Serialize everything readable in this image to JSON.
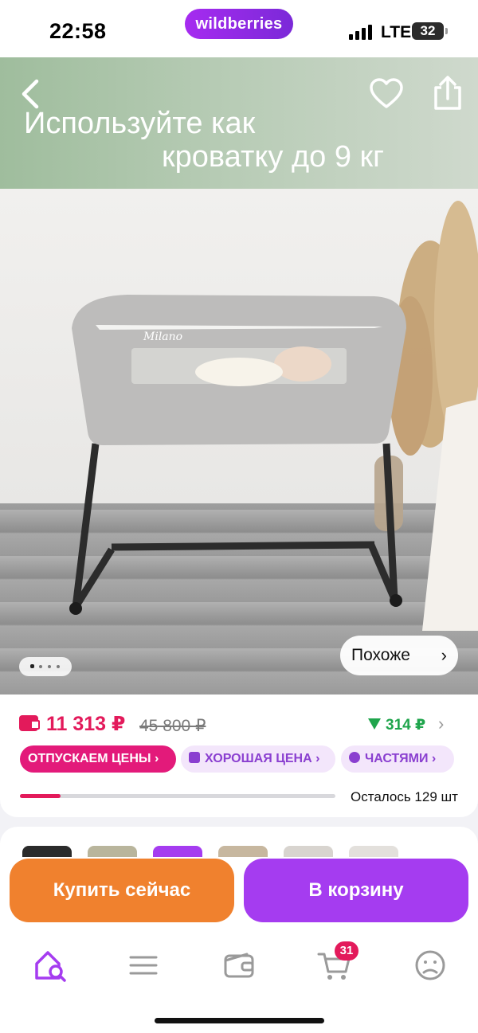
{
  "status_bar": {
    "time": "22:58",
    "app_pill": "wildberries",
    "network": "LTE",
    "battery": "32"
  },
  "hero": {
    "banner_line1": "Используйте как",
    "banner_line2": "кроватку до 9 кг",
    "crib_label": "Milano",
    "similar_button": "Похоже",
    "page_dots": 4,
    "active_dot": 1
  },
  "price": {
    "current": "11 313 ₽",
    "old": "45 800 ₽",
    "cashback": "314 ₽",
    "chips": [
      {
        "label": "ОТПУСКАЕМ ЦЕНЫ",
        "icon": "",
        "chevron": "›"
      },
      {
        "label": "ХОРОШАЯ ЦЕНА",
        "icon": "thumbs-up-icon",
        "chevron": "›"
      },
      {
        "label": "ЧАСТЯМИ",
        "icon": "pie-chart-icon",
        "chevron": "›"
      }
    ],
    "stock_progress": 0.13,
    "stock_text": "Осталось 129 шт"
  },
  "actions": {
    "buy_now": "Купить сейчас",
    "add_to_cart": "В корзину"
  },
  "tabbar": {
    "tabs": [
      "home-search-icon",
      "catalog-icon",
      "wallet-icon",
      "cart-icon",
      "profile-icon"
    ],
    "cart_badge": "31"
  },
  "colors": {
    "accent_purple": "#a53cf0",
    "accent_orange": "#f0812e",
    "price_red": "#e31a5b",
    "cashback_green": "#1fa54c",
    "chip_pink": "#e31a7a"
  }
}
